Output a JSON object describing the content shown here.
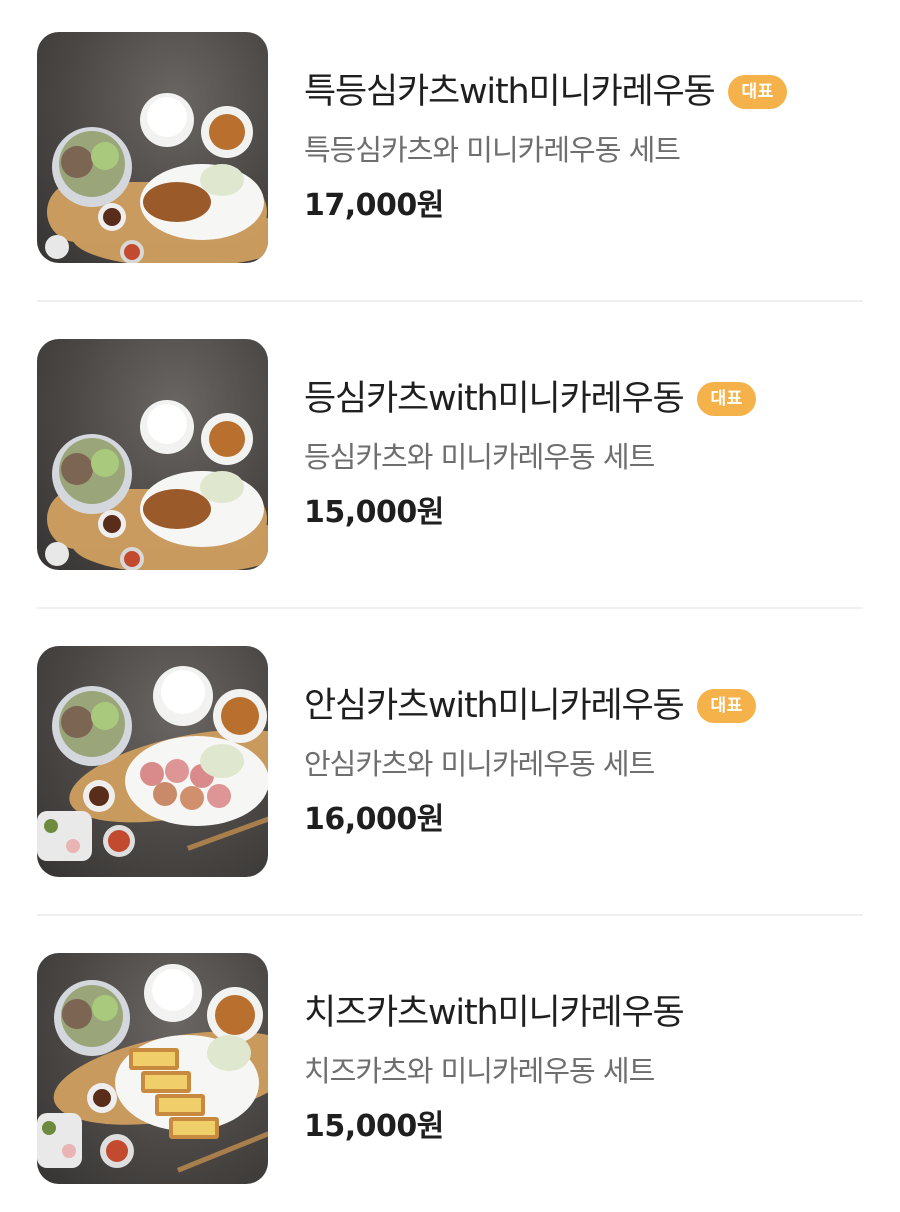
{
  "menu": {
    "items": [
      {
        "name": "특등심카츠with미니카레우동",
        "badge": "대표",
        "description": "특등심카츠와 미니카레우동 세트",
        "price": "17,000원",
        "image": "sirloin-katsu-set-photo"
      },
      {
        "name": "등심카츠with미니카레우동",
        "badge": "대표",
        "description": "등심카츠와 미니카레우동 세트",
        "price": "15,000원",
        "image": "pork-loin-katsu-set-photo"
      },
      {
        "name": "안심카츠with미니카레우동",
        "badge": "대표",
        "description": "안심카츠와 미니카레우동 세트",
        "price": "16,000원",
        "image": "tenderloin-katsu-set-photo"
      },
      {
        "name": "치즈카츠with미니카레우동",
        "description": "치즈카츠와 미니카레우동 세트",
        "price": "15,000원",
        "image": "cheese-katsu-set-photo"
      }
    ]
  },
  "colors": {
    "badge_bg": "#f6b24a",
    "text_primary": "#1f1f1f",
    "text_secondary": "#6e6e6e",
    "divider": "#f0f0f0"
  }
}
